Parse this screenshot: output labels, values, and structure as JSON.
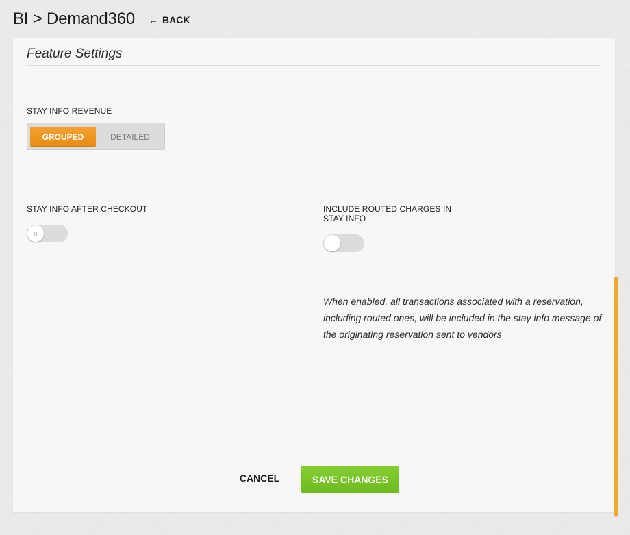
{
  "header": {
    "breadcrumb": "BI > Demand360",
    "back_label": "BACK",
    "back_icon": "left-arrow-icon"
  },
  "section": {
    "title": "Feature Settings"
  },
  "stay_info_revenue": {
    "label": "STAY INFO REVENUE",
    "options": [
      "GROUPED",
      "DETAILED"
    ],
    "selected": "GROUPED"
  },
  "stay_info_after_checkout": {
    "label": "STAY INFO AFTER CHECKOUT",
    "enabled": false
  },
  "include_routed_charges": {
    "label": "INCLUDE ROUTED CHARGES IN STAY INFO",
    "enabled": false,
    "description": "When enabled, all transactions associated with a reservation, including routed ones, will be included in the stay info message of the originating reservation sent to vendors"
  },
  "footer": {
    "cancel_label": "CANCEL",
    "save_label": "SAVE CHANGES"
  },
  "colors": {
    "accent_orange": "#f0961f",
    "save_green": "#78c428",
    "toggle_off": "#dcdcdc"
  }
}
